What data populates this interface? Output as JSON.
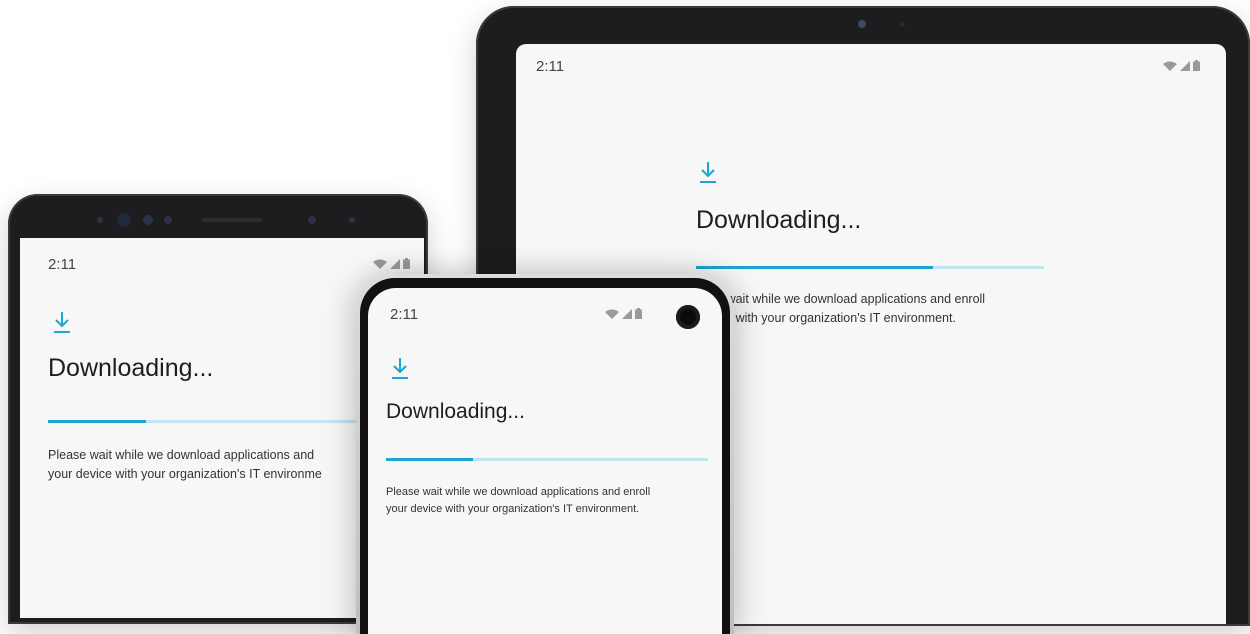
{
  "status_time": "2:11",
  "icons": {
    "download": "download-arrow-icon",
    "wifi": "wifi-icon",
    "signal": "cellular-signal-icon",
    "battery": "battery-icon"
  },
  "colors": {
    "accent": "#1ba6d3",
    "accent_light": "#bfe6f2",
    "screen_bg": "#f7f7f7",
    "frame_dark": "#1d1d1f"
  },
  "screen": {
    "title": "Downloading...",
    "description_line1": "Please wait while we download applications and enroll",
    "description_line2": "your device with your organization's IT environment."
  },
  "devices": {
    "tablet": {
      "title": "Downloading...",
      "description_line1": "ease wait while we download applications and enroll",
      "description_line2": "device with your organization's IT environment.",
      "progress": 0.68
    },
    "phone_left": {
      "title": "Downloading...",
      "description_line1": "Please wait while we download applications and",
      "description_line2": "your device with your organization's IT environme",
      "progress": 0.26
    },
    "phone_front": {
      "title": "Downloading...",
      "description_line1": "Please wait while we download applications and enroll",
      "description_line2": "your device with your organization's IT environment.",
      "progress": 0.27
    }
  }
}
